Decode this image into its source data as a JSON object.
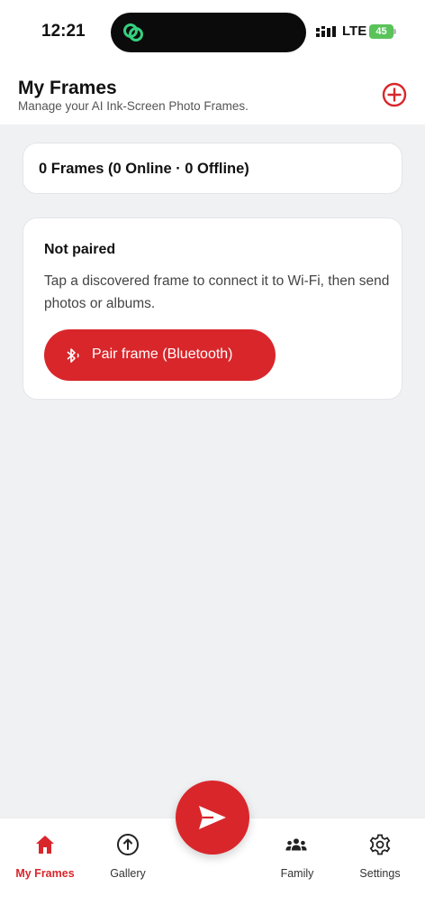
{
  "status_bar": {
    "time": "12:21",
    "network": "LTE",
    "battery": "45"
  },
  "header": {
    "title": "My Frames",
    "subtitle": "Manage your AI Ink-Screen Photo Frames.",
    "add_icon": "plus-circle-icon"
  },
  "summary": {
    "text": "0 Frames (0 Online · 0 Offline)"
  },
  "pairing": {
    "title": "Not paired",
    "description": "Tap a discovered frame to connect it to Wi-Fi, then send photos or albums.",
    "button_label": "Pair frame (Bluetooth)",
    "button_icon": "bluetooth-icon"
  },
  "fab": {
    "icon": "send-icon"
  },
  "nav": {
    "items": [
      {
        "label": "My Frames",
        "icon": "home-icon",
        "active": true
      },
      {
        "label": "Gallery",
        "icon": "upload-circle-icon",
        "active": false
      },
      {
        "label": "Family",
        "icon": "people-icon",
        "active": false
      },
      {
        "label": "Settings",
        "icon": "gear-icon",
        "active": false
      }
    ]
  },
  "colors": {
    "accent": "#d9262b",
    "background": "#f0f1f3",
    "battery": "#59c35a"
  }
}
